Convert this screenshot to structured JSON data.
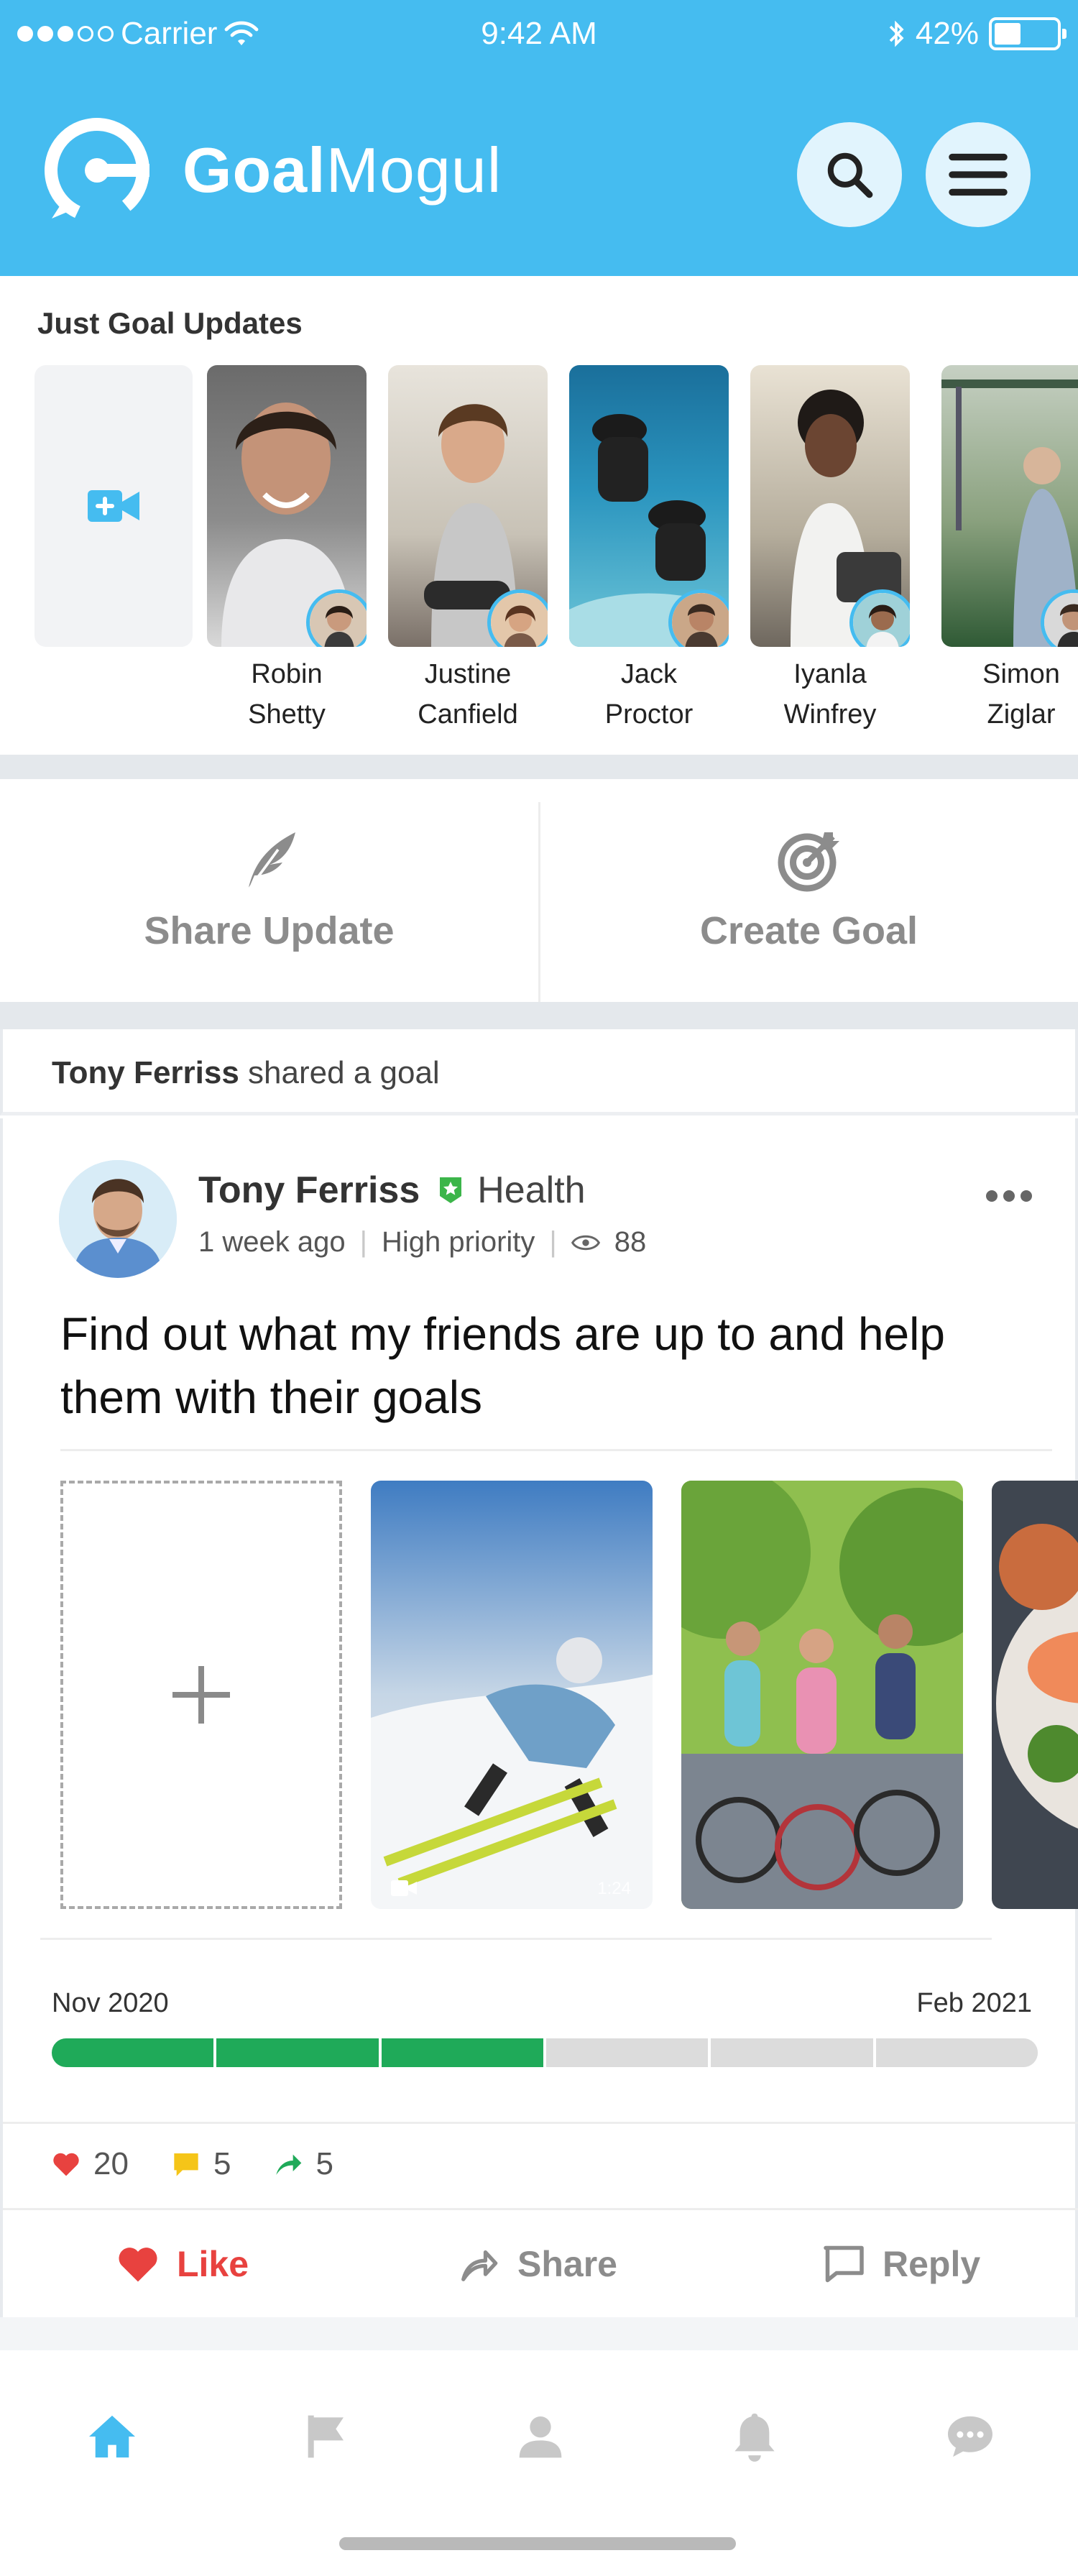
{
  "status_bar": {
    "carrier": "Carrier",
    "time": "9:42 AM",
    "battery": "42%"
  },
  "header": {
    "brand_bold": "Goal",
    "brand_regular": "Mogul",
    "accent_color": "#45BCF0"
  },
  "stories": {
    "title": "Just Goal Updates",
    "items": [
      {
        "first": "Robin",
        "last": "Shetty"
      },
      {
        "first": "Justine",
        "last": "Canfield"
      },
      {
        "first": "Jack",
        "last": "Proctor"
      },
      {
        "first": "Iyanla",
        "last": "Winfrey"
      },
      {
        "first": "Simon",
        "last": "Ziglar"
      }
    ]
  },
  "actions": {
    "share_update": "Share Update",
    "create_goal": "Create Goal"
  },
  "post": {
    "shared_by": "Tony Ferriss",
    "shared_text": " shared a goal",
    "author": "Tony Ferriss",
    "category": "Health",
    "time_ago": "1 week ago",
    "priority": "High priority",
    "views": "88",
    "goal_text": "Find out what my friends are up to and help them with their goals",
    "video_duration": "1:24",
    "start_date": "Nov 2020",
    "end_date": "Feb 2021",
    "progress": {
      "completed_steps": 3,
      "total_steps": 6
    },
    "stats": {
      "likes": "20",
      "comments": "5",
      "shares": "5"
    },
    "buttons": {
      "like": "Like",
      "share": "Share",
      "reply": "Reply"
    }
  },
  "tabbar": {
    "items": [
      "home-icon",
      "flag-icon",
      "profile-icon",
      "bell-icon",
      "chat-icon"
    ],
    "active_color": "#45BCF0",
    "inactive_color": "#C8C8C8"
  }
}
